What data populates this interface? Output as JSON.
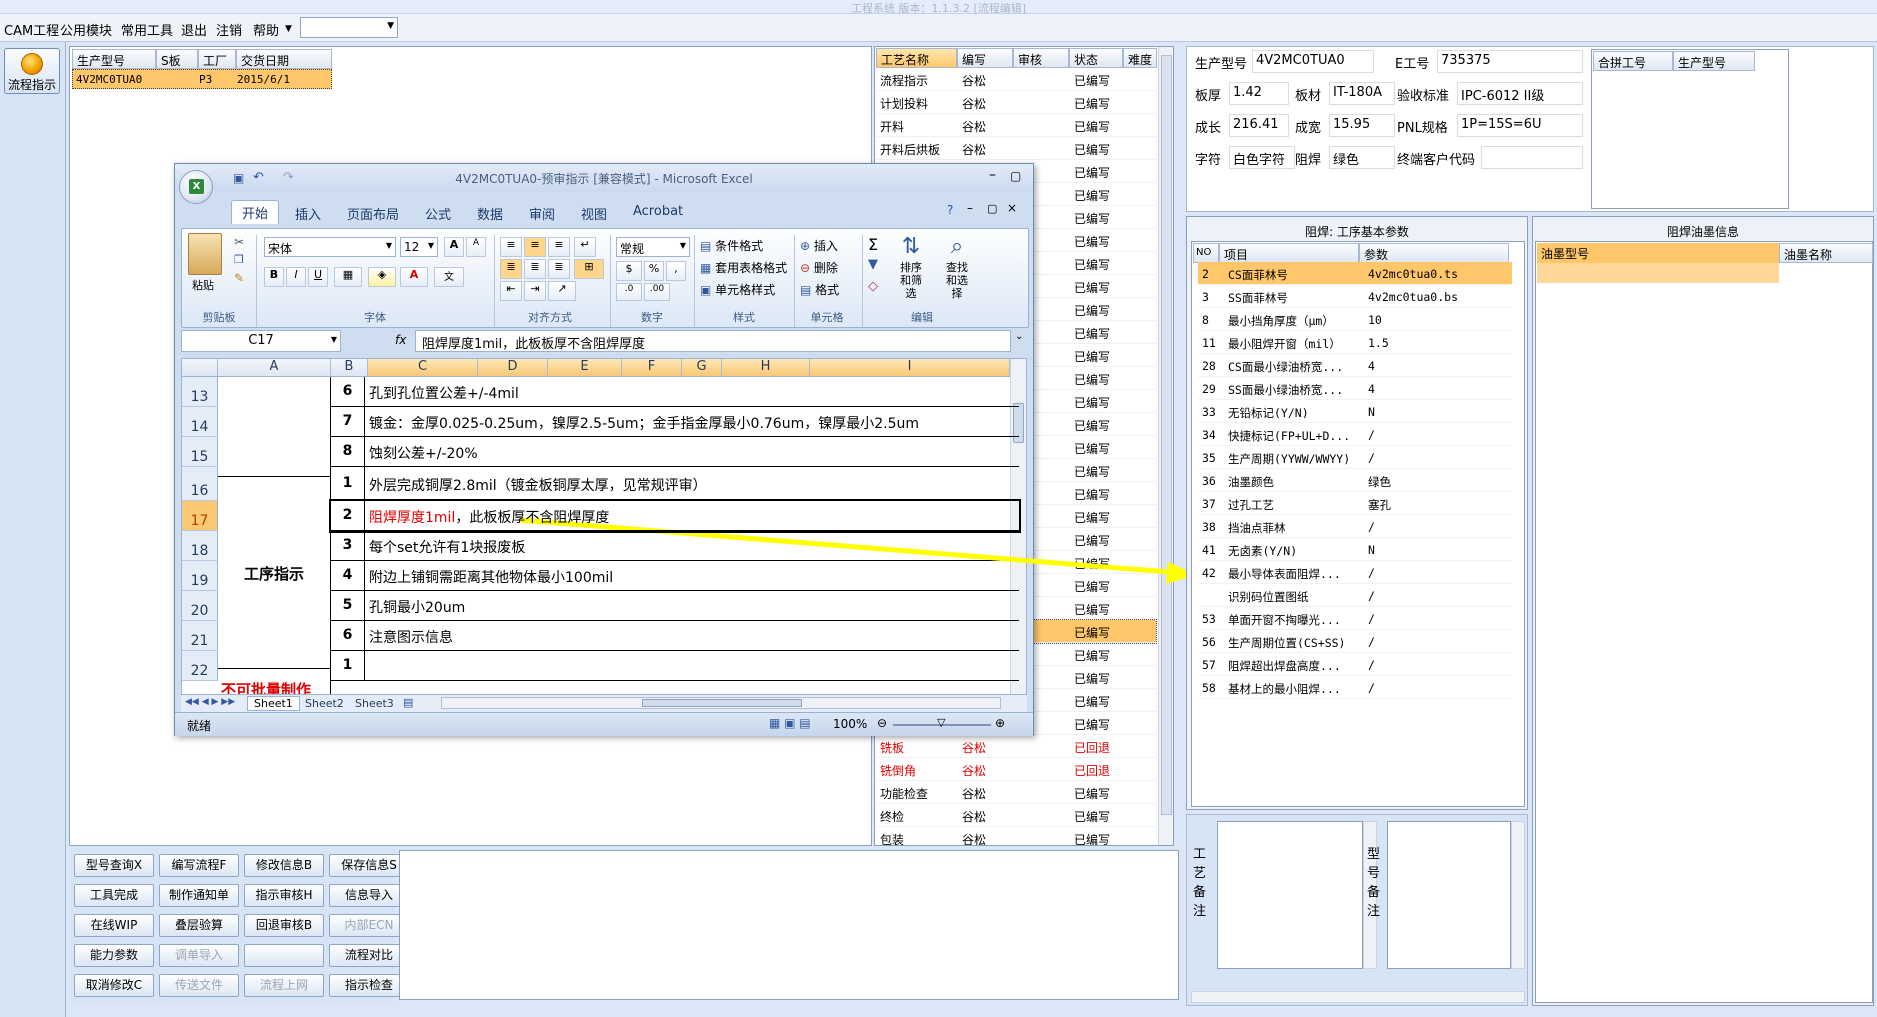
{
  "window_title": "工程系统   版本：1.1.3.2   [流程编辑]",
  "menu": [
    "CAM工程",
    "公用模块",
    "常用工具",
    "退出",
    "注销",
    "帮助"
  ],
  "left_nav": {
    "flow_button": "流程指示"
  },
  "job_table": {
    "headers": [
      "生产型号",
      "S板",
      "工厂",
      "交货日期"
    ],
    "row": [
      "4V2MC0TUA0",
      "",
      "P3",
      "2015/6/1"
    ]
  },
  "process_table": {
    "headers": [
      "工艺名称",
      "编写",
      "审核",
      "状态",
      "难度"
    ],
    "rows": [
      [
        "流程指示",
        "谷松",
        "",
        "已编写"
      ],
      [
        "计划投料",
        "谷松",
        "",
        "已编写"
      ],
      [
        "开料",
        "谷松",
        "",
        "已编写"
      ],
      [
        "开料后烘板",
        "谷松",
        "",
        "已编写"
      ],
      [
        "",
        "",
        "",
        "已编写"
      ],
      [
        "",
        "",
        "",
        "已编写"
      ],
      [
        "",
        "",
        "",
        "已编写"
      ],
      [
        "",
        "",
        "",
        "已编写"
      ],
      [
        "",
        "",
        "",
        "已编写"
      ],
      [
        "",
        "",
        "",
        "已编写"
      ],
      [
        "",
        "",
        "",
        "已编写"
      ],
      [
        "",
        "",
        "",
        "已编写"
      ],
      [
        "",
        "",
        "",
        "已编写"
      ],
      [
        "",
        "",
        "",
        "已编写"
      ],
      [
        "",
        "",
        "",
        "已编写"
      ],
      [
        "",
        "",
        "",
        "已编写"
      ],
      [
        "",
        "",
        "",
        "已编写"
      ],
      [
        "",
        "",
        "",
        "已编写"
      ],
      [
        "",
        "",
        "",
        "已编写"
      ],
      [
        "",
        "",
        "",
        "已编写"
      ],
      [
        "",
        "",
        "",
        "已编写"
      ],
      [
        "",
        "",
        "",
        "已编写"
      ],
      [
        "",
        "",
        "",
        "已编写"
      ],
      [
        "",
        "",
        "",
        "已编写"
      ],
      [
        "",
        "",
        "",
        "已编写"
      ],
      [
        "",
        "",
        "",
        "已编写"
      ],
      [
        "",
        "",
        "",
        "已编写"
      ],
      [
        "",
        "",
        "",
        "已编写"
      ],
      [
        "",
        "",
        "",
        "已编写"
      ],
      [
        "铣板",
        "谷松",
        "",
        "已回退"
      ],
      [
        "铣倒角",
        "谷松",
        "",
        "已回退"
      ],
      [
        "功能检查",
        "谷松",
        "",
        "已编写"
      ],
      [
        "终检",
        "谷松",
        "",
        "已编写"
      ],
      [
        "包装",
        "谷松",
        "",
        "已编写"
      ]
    ]
  },
  "excel": {
    "title": "4V2MC0TUA0-预审指示  [兼容模式] - Microsoft Excel",
    "tabs": [
      "开始",
      "插入",
      "页面布局",
      "公式",
      "数据",
      "审阅",
      "视图",
      "Acrobat"
    ],
    "font_name": "宋体",
    "font_size": "12",
    "number_format": "常规",
    "groups": [
      "剪贴板",
      "字体",
      "对齐方式",
      "数字",
      "样式",
      "单元格",
      "编辑"
    ],
    "paste": "粘贴",
    "styles": [
      "条件格式",
      "套用表格格式",
      "单元格样式"
    ],
    "cells_btns": [
      "插入",
      "删除",
      "格式"
    ],
    "edit_btns": [
      "排序和筛选",
      "查找和选择"
    ],
    "name_box": "C17",
    "formula": "阻焊厚度1mil，此板板厚不含阻焊厚度",
    "columns": [
      "A",
      "B",
      "C",
      "D",
      "E",
      "F",
      "G",
      "H",
      "I"
    ],
    "rows": [
      {
        "r": "13",
        "n": "6",
        "t": "孔到孔位置公差+/-4mil"
      },
      {
        "r": "14",
        "n": "7",
        "t": "镀金：金厚0.025-0.25um，镍厚2.5-5um；金手指金厚最小0.76um，镍厚最小2.5um"
      },
      {
        "r": "15",
        "n": "8",
        "t": "蚀刻公差+/-20%"
      },
      {
        "r": "16",
        "n": "1",
        "t": "外层完成铜厚2.8mil（镀金板铜厚太厚，见常规评审）"
      },
      {
        "r": "17",
        "n": "2",
        "t_red": "阻焊厚度1mil",
        "t": "，此板板厚不含阻焊厚度"
      },
      {
        "r": "18",
        "n": "3",
        "t": "每个set允许有1块报废板"
      },
      {
        "r": "19",
        "n": "4",
        "t": "附边上铺铜需距离其他物体最小100mil"
      },
      {
        "r": "20",
        "n": "5",
        "t": "孔铜最小20um"
      },
      {
        "r": "21",
        "n": "6",
        "t": "注意图示信息"
      },
      {
        "r": "22",
        "n": "1",
        "t": ""
      }
    ],
    "merged_label": "工序指示",
    "red_label": "不可批量制作",
    "sheets": [
      "Sheet1",
      "Sheet2",
      "Sheet3"
    ],
    "status": "就绪",
    "zoom": "100%"
  },
  "buttons": [
    [
      "型号查询X",
      "编写流程F",
      "修改信息B",
      "保存信息S"
    ],
    [
      "工具完成",
      "制作通知单",
      "指示审核H",
      "信息导入"
    ],
    [
      "在线WIP",
      "叠层验算",
      "回退审核B",
      "内部ECN"
    ],
    [
      "能力参数",
      "调单导入",
      "",
      "流程对比"
    ],
    [
      "取消修改C",
      "传送文件",
      "流程上网",
      "指示检查"
    ]
  ],
  "disabled_buttons": [
    "内部ECN",
    "调单导入",
    "传送文件",
    "流程上网"
  ],
  "info": {
    "model_label": "生产型号",
    "model": "4V2MC0TUA0",
    "e_label": "E工号",
    "e": "735375",
    "thick_label": "板厚",
    "thick": "1.42",
    "mat_label": "板材",
    "mat": "IT-180A",
    "std_label": "验收标准",
    "std": "IPC-6012 II级",
    "len_label": "成长",
    "len": "216.41",
    "wid_label": "成宽",
    "wid": "15.95",
    "pnl_label": "PNL规格",
    "pnl": "1P=15S=6U",
    "char_label": "字符",
    "char": "白色字符",
    "mask_label": "阻焊",
    "mask": "绿色",
    "cust_label": "终端客户代码",
    "cust": ""
  },
  "merge_table": {
    "headers": [
      "合拼工号",
      "生产型号"
    ]
  },
  "params": {
    "title": "阻焊: 工序基本参数",
    "headers": [
      "NO",
      "项目",
      "参数"
    ],
    "rows": [
      [
        "2",
        "CS面菲林号",
        "4v2mc0tua0.ts"
      ],
      [
        "3",
        "SS面菲林号",
        "4v2mc0tua0.bs"
      ],
      [
        "8",
        "最小挡角厚度（μm）",
        "10"
      ],
      [
        "11",
        "最小阻焊开窗（mil）",
        "1.5"
      ],
      [
        "28",
        "CS面最小绿油桥宽...",
        "4"
      ],
      [
        "29",
        "SS面最小绿油桥宽...",
        "4"
      ],
      [
        "33",
        "无铅标记(Y/N)",
        "N"
      ],
      [
        "34",
        "快捷标记(FP+UL+D...",
        "/"
      ],
      [
        "35",
        "生产周期(YYWW/WWYY)",
        "/"
      ],
      [
        "36",
        "油墨颜色",
        "绿色"
      ],
      [
        "37",
        "过孔工艺",
        "塞孔"
      ],
      [
        "38",
        "挡油点菲林",
        "/"
      ],
      [
        "41",
        "无卤素(Y/N)",
        "N"
      ],
      [
        "42",
        "最小导体表面阻焊...",
        "/"
      ],
      [
        "",
        "识别码位置图纸",
        "/"
      ],
      [
        "53",
        "单面开窗不掏曝光...",
        "/"
      ],
      [
        "56",
        "生产周期位置(CS+SS)",
        "/"
      ],
      [
        "57",
        "阻焊超出焊盘高度...",
        "/"
      ],
      [
        "58",
        "基材上的最小阻焊...",
        "/"
      ]
    ]
  },
  "ink": {
    "title": "阻焊油墨信息",
    "headers": [
      "油墨型号",
      "油墨名称"
    ]
  },
  "notes": {
    "craft": "工艺备注",
    "model": "型号备注"
  },
  "colors": {
    "highlight": "#ffc66a",
    "annotation": "#ffff00",
    "red": "#e00000"
  }
}
